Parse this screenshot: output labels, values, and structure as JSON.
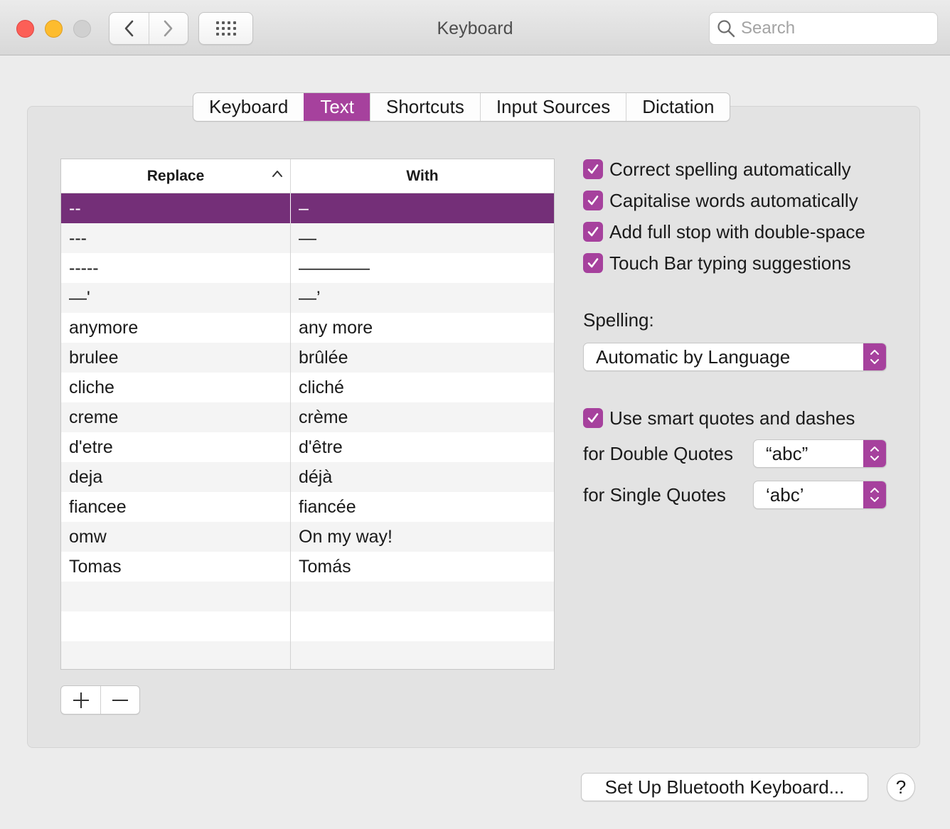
{
  "window": {
    "title": "Keyboard",
    "search": {
      "placeholder": "Search",
      "value": ""
    }
  },
  "tabs": [
    {
      "label": "Keyboard",
      "active": false
    },
    {
      "label": "Text",
      "active": true
    },
    {
      "label": "Shortcuts",
      "active": false
    },
    {
      "label": "Input Sources",
      "active": false
    },
    {
      "label": "Dictation",
      "active": false
    }
  ],
  "table": {
    "columns": {
      "replace": "Replace",
      "with": "With"
    },
    "sort": "ascending",
    "selected_index": 0,
    "rows": [
      {
        "replace": "--",
        "with": "–"
      },
      {
        "replace": "---",
        "with": "—"
      },
      {
        "replace": "-----",
        "with": "————"
      },
      {
        "replace": "—'",
        "with": "—’"
      },
      {
        "replace": "anymore",
        "with": "any more"
      },
      {
        "replace": "brulee",
        "with": "brûlée"
      },
      {
        "replace": "cliche",
        "with": "cliché"
      },
      {
        "replace": "creme",
        "with": "crème"
      },
      {
        "replace": "d'etre",
        "with": "d'être"
      },
      {
        "replace": "deja",
        "with": "déjà"
      },
      {
        "replace": "fiancee",
        "with": "fiancée"
      },
      {
        "replace": "omw",
        "with": "On my way!"
      },
      {
        "replace": "Tomas",
        "with": "Tomás"
      }
    ],
    "add_label": "+",
    "remove_label": "−"
  },
  "options": {
    "correct_spelling": {
      "label": "Correct spelling automatically",
      "checked": true
    },
    "capitalise_words": {
      "label": "Capitalise words automatically",
      "checked": true
    },
    "full_stop": {
      "label": "Add full stop with double-space",
      "checked": true
    },
    "touch_bar": {
      "label": "Touch Bar typing suggestions",
      "checked": true
    },
    "spelling_label": "Spelling:",
    "spelling_value": "Automatic by Language",
    "smart_quotes": {
      "label": "Use smart quotes and dashes",
      "checked": true
    },
    "double_quotes_label": "for Double Quotes",
    "double_quotes_value": "“abc”",
    "single_quotes_label": "for Single Quotes",
    "single_quotes_value": "‘abc’"
  },
  "footer": {
    "bluetooth_button": "Set Up Bluetooth Keyboard...",
    "help_button": "?"
  },
  "colors": {
    "accent": "#a6419d",
    "selection": "#742f78"
  }
}
